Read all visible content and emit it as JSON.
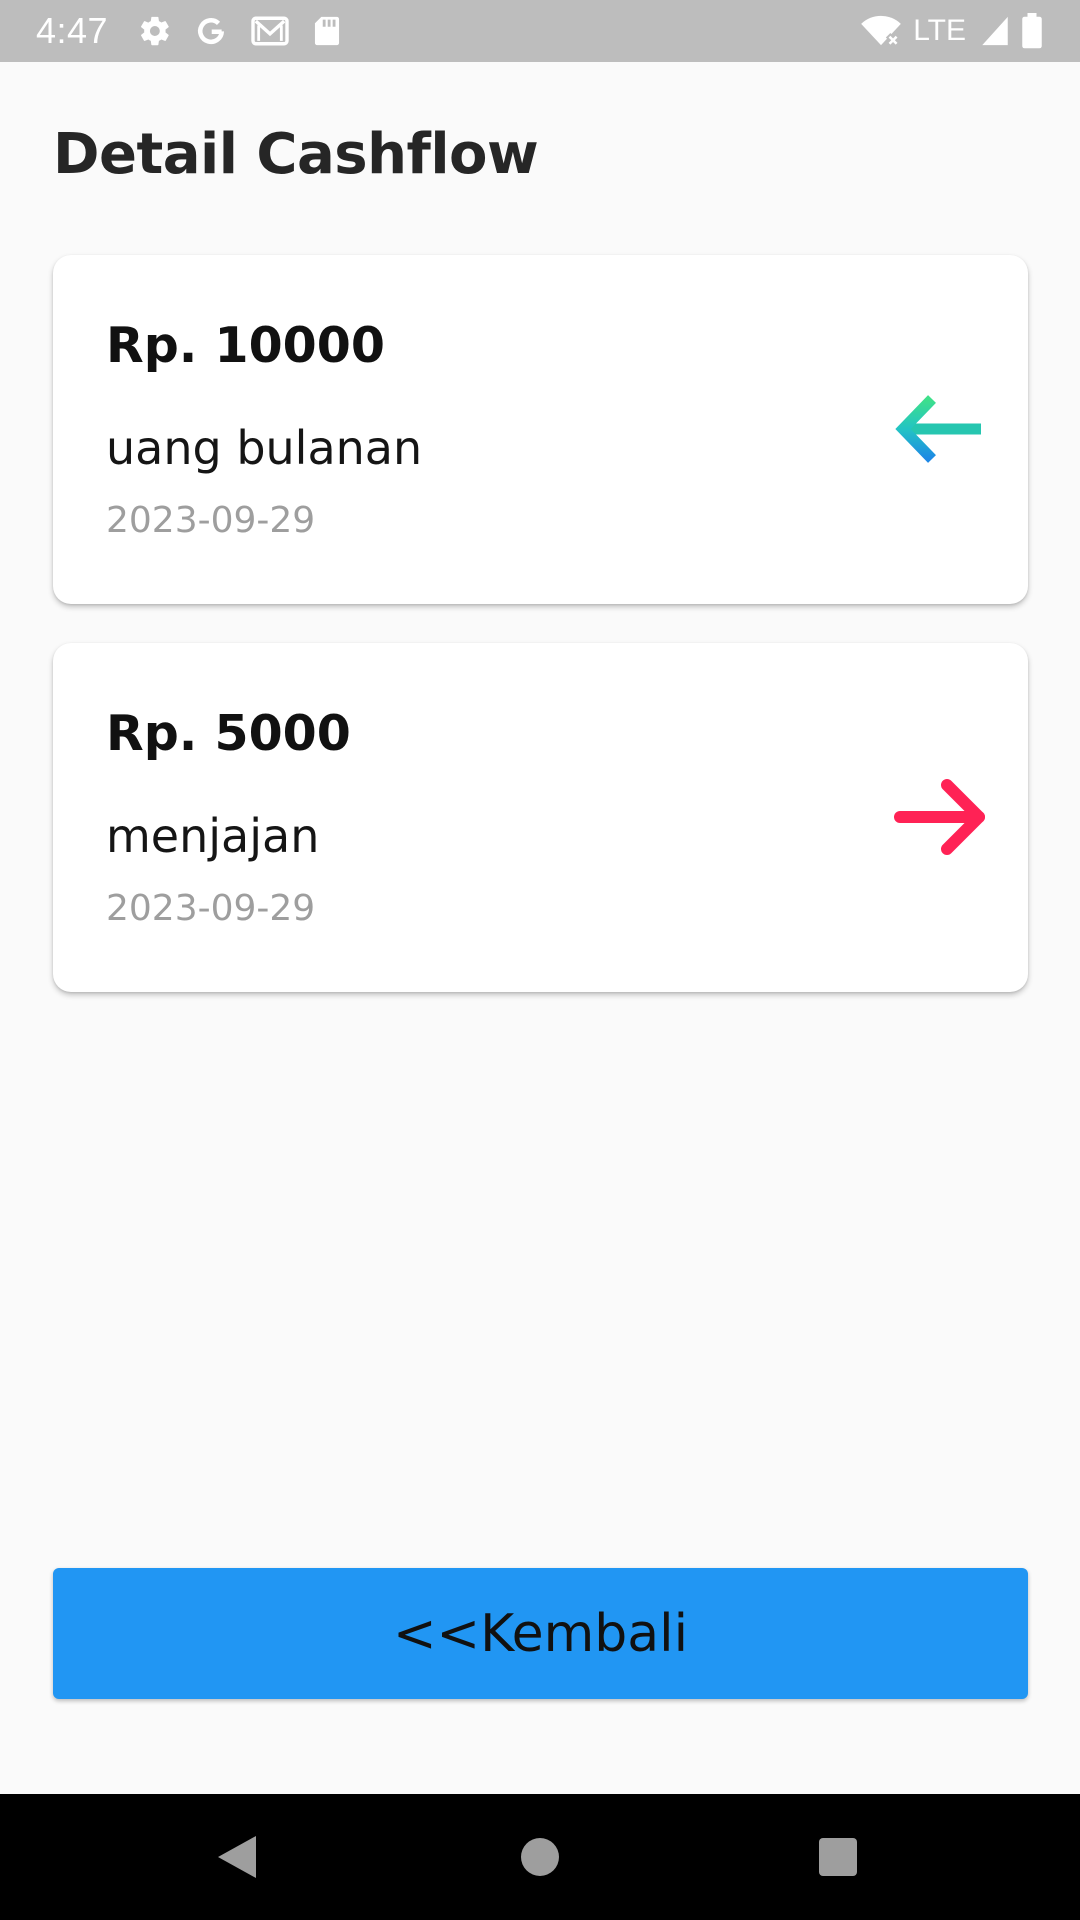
{
  "status_bar": {
    "time": "4:47",
    "network": "LTE",
    "icons_left": [
      "settings-icon",
      "google-icon",
      "gmail-icon",
      "sd-card-icon"
    ],
    "icons_right": [
      "wifi-off-icon",
      "signal-icon",
      "battery-icon"
    ]
  },
  "page": {
    "title": "Detail Cashflow"
  },
  "transactions": [
    {
      "amount": "Rp. 10000",
      "description": "uang bulanan",
      "date": "2023-09-29",
      "direction": "in",
      "icon": "arrow-left-icon",
      "color": "#26c6b0"
    },
    {
      "amount": "Rp. 5000",
      "description": "menjajan",
      "date": "2023-09-29",
      "direction": "out",
      "icon": "arrow-right-icon",
      "color": "#ff2255"
    }
  ],
  "footer": {
    "back_label": "<<Kembali",
    "back_color": "#2196f3"
  },
  "nav_bar": {
    "buttons": [
      "back-icon",
      "home-icon",
      "recents-icon"
    ]
  }
}
